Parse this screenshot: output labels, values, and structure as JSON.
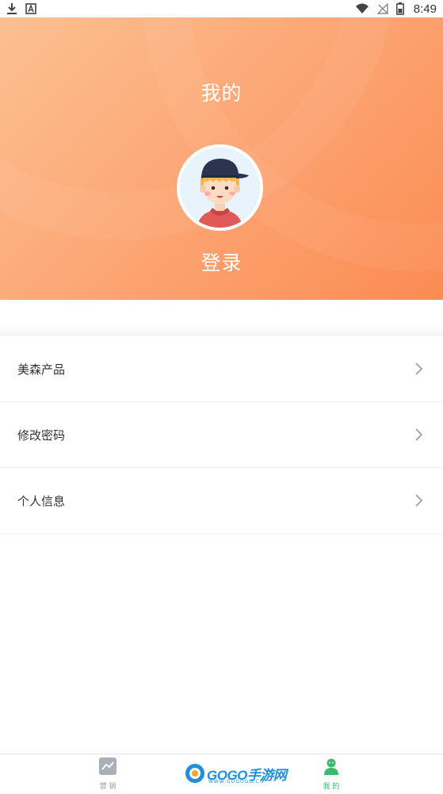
{
  "status_bar": {
    "time": "8:49",
    "icons": [
      "download-icon",
      "a-icon",
      "wifi-icon",
      "no-signal-icon",
      "battery-icon"
    ]
  },
  "header": {
    "title": "我的",
    "login_label": "登录",
    "gradient": [
      "#fcc091",
      "#fb8b52"
    ]
  },
  "menu": {
    "items": [
      {
        "label": "美森产品"
      },
      {
        "label": "修改密码"
      },
      {
        "label": "个人信息"
      }
    ]
  },
  "tabbar": {
    "tabs": [
      {
        "label": "营 销",
        "icon": "trend-chart-icon",
        "active": false
      },
      {
        "label": "我 的",
        "icon": "user-icon",
        "active": true
      }
    ],
    "active_color": "#3dbb6c",
    "inactive_color": "#9a9a9a"
  },
  "watermark": {
    "text": "GOGO手游网",
    "url": "WWW.GOGOGO.CN"
  }
}
